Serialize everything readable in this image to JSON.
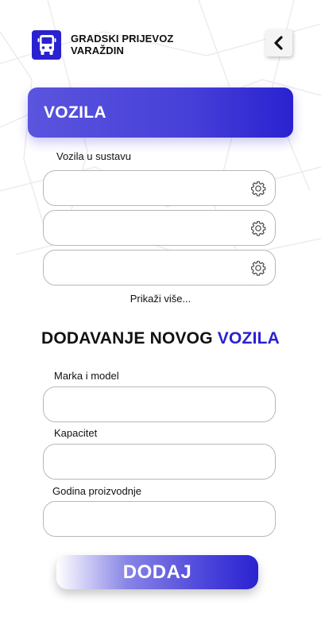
{
  "header": {
    "app_title_line1": "GRADSKI PRIJEVOZ",
    "app_title_line2": "VARAŽDIN",
    "logo_icon": "bus-icon",
    "back_icon": "chevron-left-icon"
  },
  "vehicles_section": {
    "title": "VOZILA",
    "list_label": "Vozila u sustavu",
    "items": [
      {
        "value": "",
        "action_icon": "gear-icon"
      },
      {
        "value": "",
        "action_icon": "gear-icon"
      },
      {
        "value": "",
        "action_icon": "gear-icon"
      }
    ],
    "show_more": "Prikaži više..."
  },
  "add_section": {
    "title_part1": "DODAVANJE NOVOG",
    "title_part2": "VOZILA",
    "fields": [
      {
        "label": "Marka i model",
        "value": ""
      },
      {
        "label": "Kapacitet",
        "value": ""
      },
      {
        "label": "Godina proizvodnje",
        "value": ""
      }
    ],
    "submit_label": "DODAJ"
  },
  "colors": {
    "accent": "#2a22d0",
    "field_border": "#b8b8b8",
    "background": "#ffffff"
  }
}
